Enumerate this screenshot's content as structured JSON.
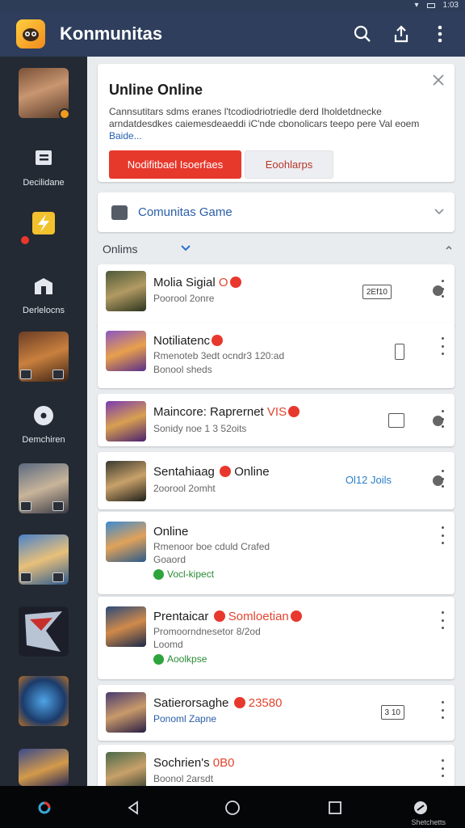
{
  "status_bar": {
    "time": "1:03"
  },
  "app_bar": {
    "title": "Konmunitas"
  },
  "sidebar": {
    "items": [
      {
        "label": ""
      },
      {
        "label": "Decilidane"
      },
      {
        "label": ""
      },
      {
        "label": "Derlelocns"
      },
      {
        "label": ""
      },
      {
        "label": "Demchiren"
      },
      {
        "label": ""
      },
      {
        "label": ""
      },
      {
        "label": ""
      },
      {
        "label": ""
      },
      {
        "label": ""
      }
    ]
  },
  "banner": {
    "title": "Unline Online",
    "body": "Cannsutitars sdms eranes l'tcodiodriotriedle derd Iholdetdnecke arndatdesdkes caiemesdeaeddi iC'nde cbonolicars teepo pere Val eoem",
    "link": "Baide...",
    "primary_button": "Nodifitbael Isoerfaes",
    "secondary_button": "Eoohlarps"
  },
  "group": {
    "title": "Comunitas Game"
  },
  "section": {
    "label": "Onlims"
  },
  "items": [
    {
      "title": "Molia Sigial",
      "title_accent": "O",
      "sub1": "Poorool 2onre",
      "trailing": "2Ef10"
    },
    {
      "title": "Notiliatenc",
      "title_accent": "",
      "sub1": "Rmenoteb 3edt ocndr3 120:ad",
      "sub2": "Bonool sheds"
    },
    {
      "title": "Maincore: Raprernet",
      "title_accent": "VIS",
      "sub1": "Sonidy noe 1 3 52oits"
    },
    {
      "title": "Sentahiaag",
      "title_accent": "",
      "title_suffix": "Online",
      "sub1": "2oorool 2omht",
      "trailing": "Ol12 Joils"
    },
    {
      "title": "Online",
      "sub1": "Rmenoor boe cduld Crafed",
      "sub2": "Goaord",
      "ok": "Vocl-kipect"
    },
    {
      "title": "Prentaicar",
      "title_accent": "Somloetian",
      "sub1": "Promoorndnesetor 8/2od",
      "sub2": "Loomd",
      "ok": "Aoolkpse"
    },
    {
      "title": "Satierorsaghe",
      "title_accent": "23580",
      "sub1": "Ponoml Zapne",
      "trailing": "3 10"
    },
    {
      "title": "Sochrien's",
      "title_accent": "0B0",
      "sub1": "Boonol 2arsdt"
    }
  ],
  "nav_bar": {
    "label": "Shetchetts"
  }
}
